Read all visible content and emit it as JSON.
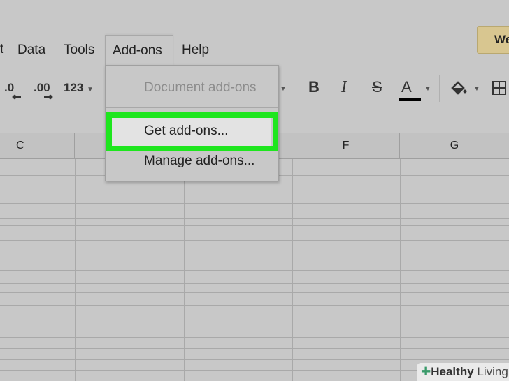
{
  "menubar": {
    "left_fragment": "t",
    "items": [
      "Data",
      "Tools",
      "Add-ons",
      "Help"
    ]
  },
  "top_right_button": "We",
  "toolbar": {
    "decrease_decimal": ".0",
    "increase_decimal": ".00",
    "more_formats": "123",
    "bold": "B",
    "italic": "I",
    "strikethrough": "S",
    "text_color": "A"
  },
  "columns": [
    "C",
    "",
    "",
    "F",
    "G"
  ],
  "addons_menu": {
    "document_addons": "Document add-ons",
    "get_addons": "Get add-ons...",
    "manage_addons": "Manage add-ons..."
  },
  "watermark": {
    "bold": "Healthy",
    "light": "Living"
  },
  "colors": {
    "highlight": "#1ee61e",
    "button": "#d8c690"
  }
}
